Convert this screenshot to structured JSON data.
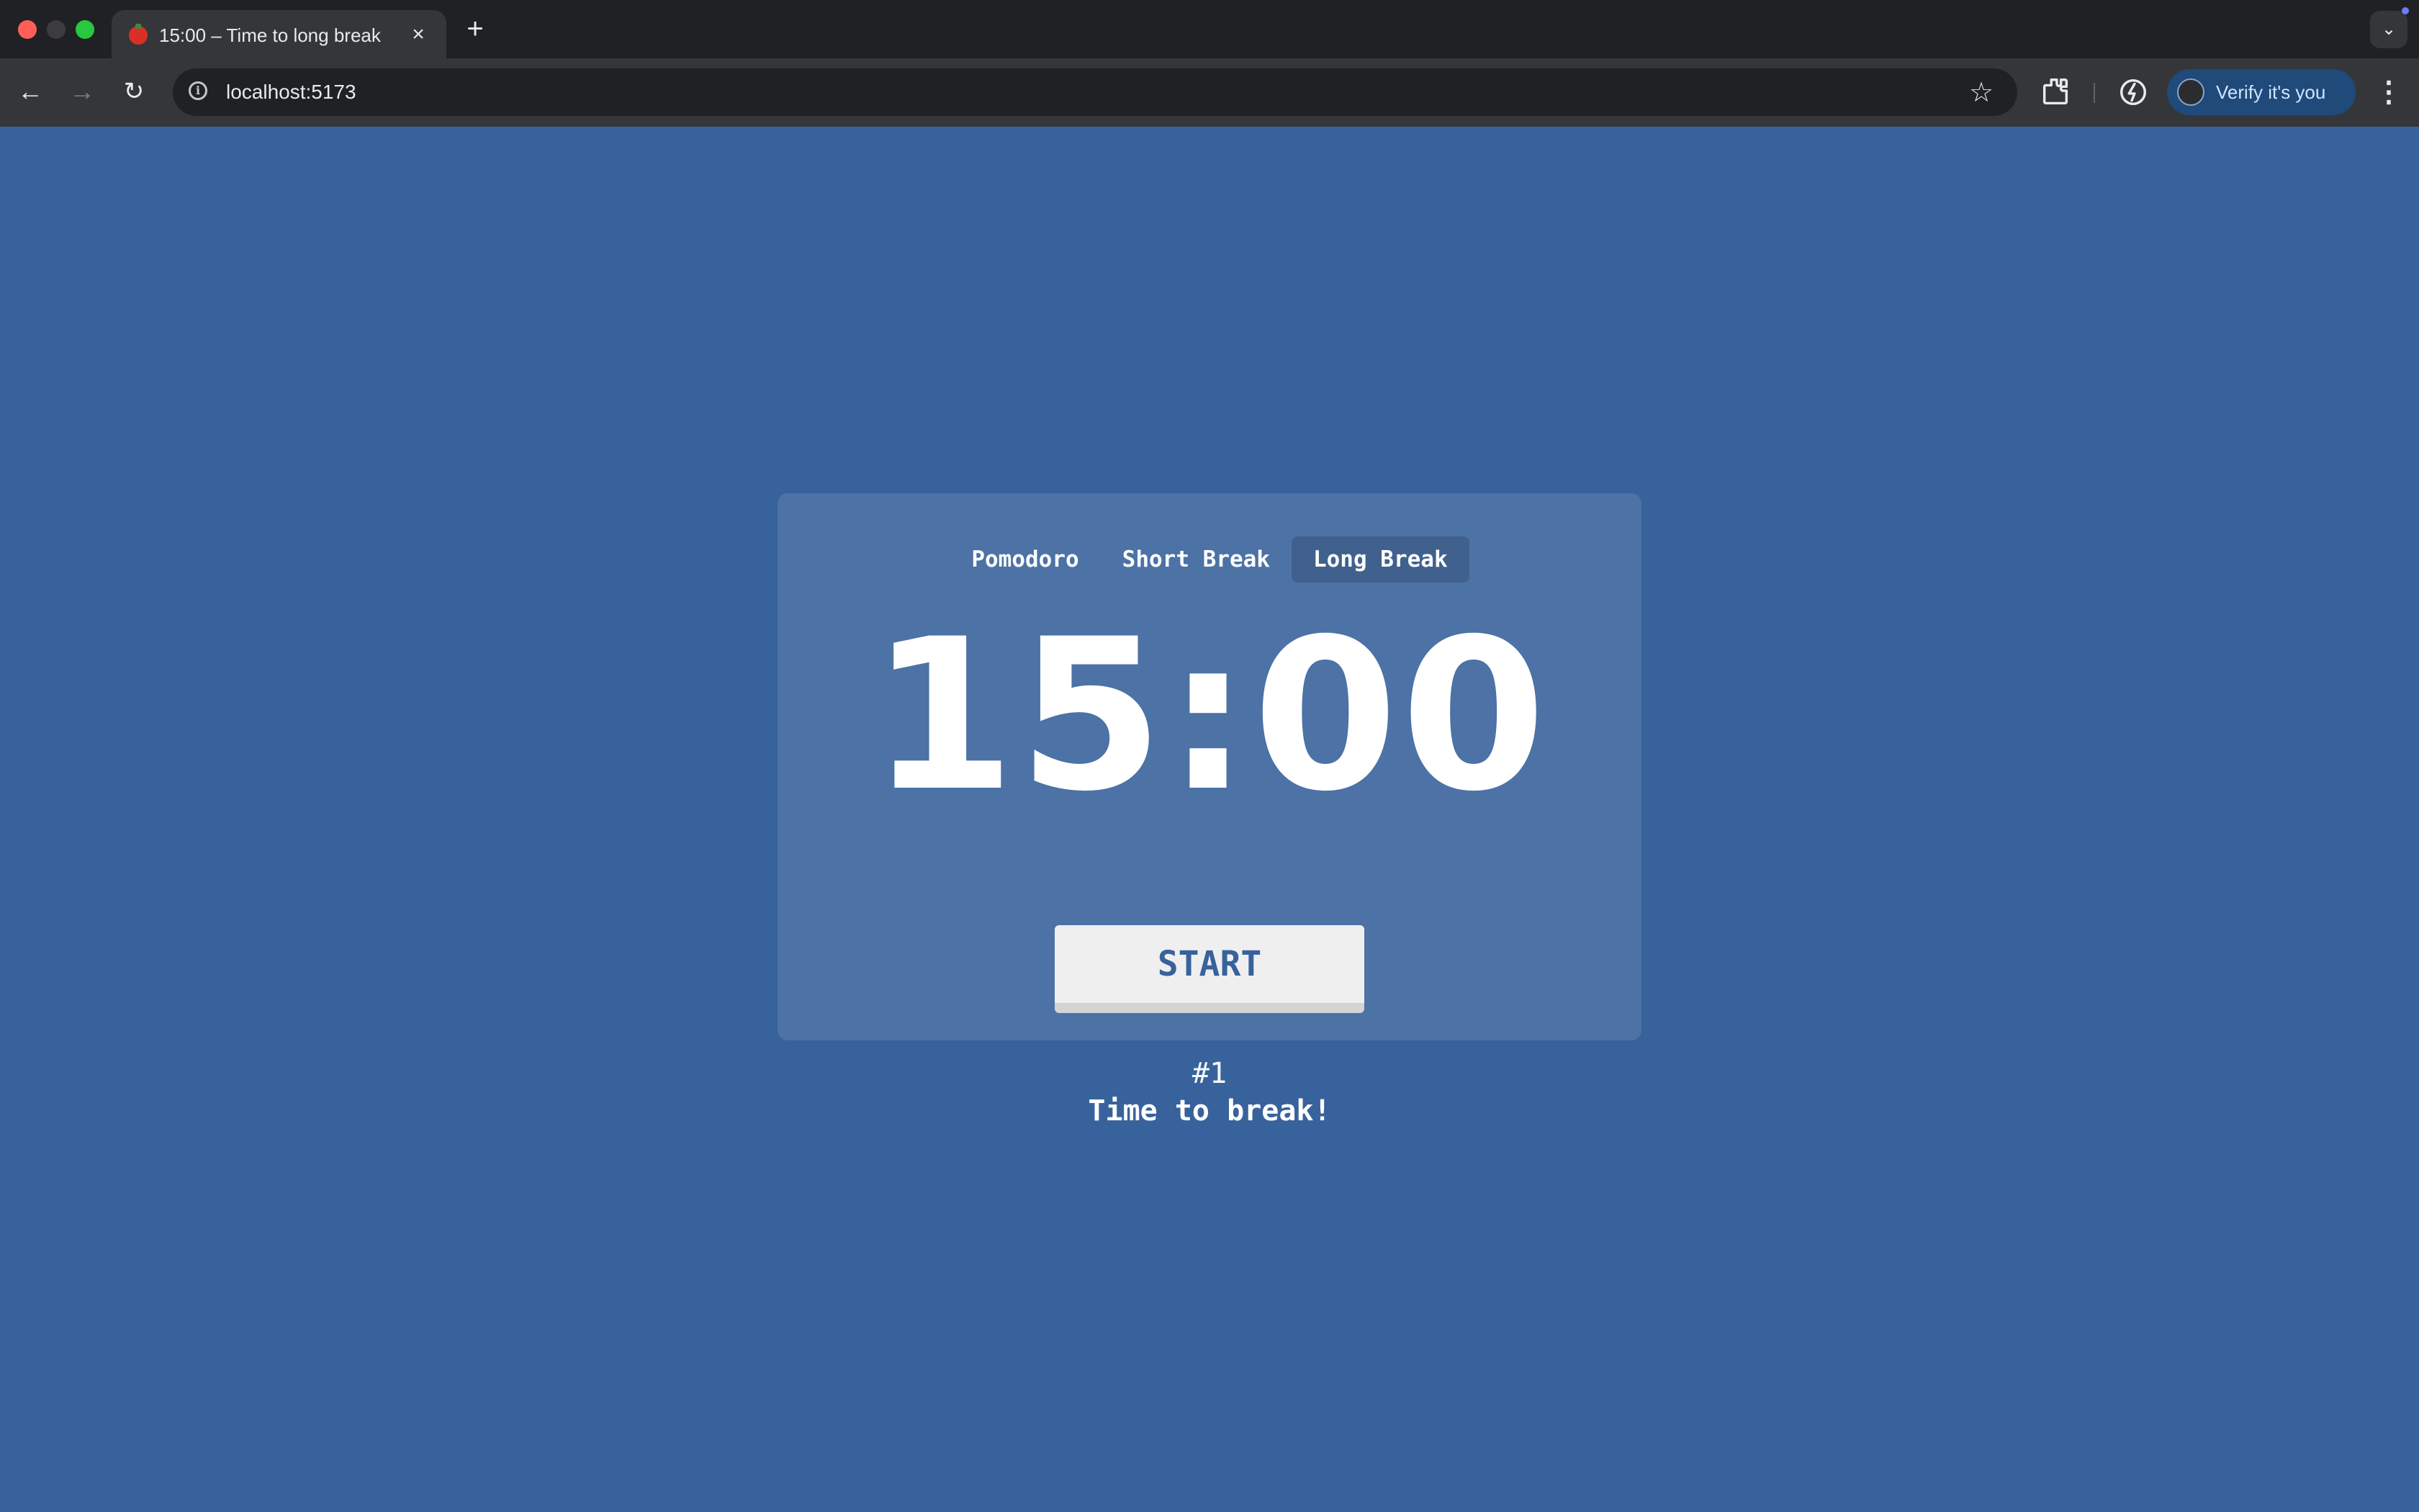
{
  "browser": {
    "tab_title": "15:00 – Time to long break",
    "close_glyph": "×",
    "new_tab_glyph": "+",
    "tab_search_glyph": "⌄",
    "url": "localhost:5173",
    "back_glyph": "←",
    "forward_glyph": "→",
    "reload_glyph": "↻",
    "star_glyph": "☆",
    "menu_glyph": "⋮",
    "verify_label": "Verify it's you",
    "icons": [
      "tomato-favicon-icon",
      "close-icon",
      "new-tab-icon",
      "tab-search-icon",
      "back-icon",
      "forward-icon",
      "reload-icon",
      "site-info-icon",
      "bookmark-star-icon",
      "extensions-icon",
      "performance-icon",
      "profile-avatar-icon",
      "menu-icon"
    ]
  },
  "app": {
    "background_color": "#38629c",
    "modes": [
      {
        "label": "Pomodoro",
        "active": false
      },
      {
        "label": "Short Break",
        "active": false
      },
      {
        "label": "Long Break",
        "active": true
      }
    ],
    "timer": "15:00",
    "start_label": "START",
    "session_counter": "#1",
    "message": "Time to break!"
  }
}
